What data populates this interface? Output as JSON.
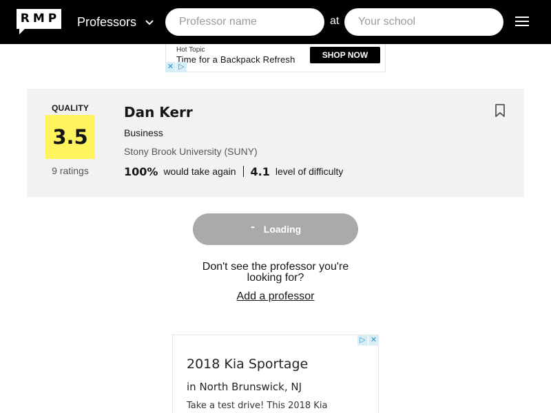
{
  "header": {
    "logo_text": "RMP",
    "search_type": "Professors",
    "professor_placeholder": "Professor name",
    "at_label": "at",
    "school_placeholder": "Your school"
  },
  "top_ad": {
    "brand": "Hot Topic",
    "headline": "Time for a Backpack Refresh",
    "cta": "SHOP NOW"
  },
  "professor": {
    "quality_label": "QUALITY",
    "quality_score": "3.5",
    "ratings_count": "9 ratings",
    "name": "Dan Kerr",
    "department": "Business",
    "school": "Stony Brook University (SUNY)",
    "would_take_again_value": "100%",
    "would_take_again_label": "would take again",
    "difficulty_value": "4.1",
    "difficulty_label": "level of difficulty"
  },
  "loading_label": "Loading",
  "not_found_text": "Don't see the professor you're looking for?",
  "add_professor_label": "Add a professor",
  "bottom_ad": {
    "title": "2018 Kia Sportage",
    "subtitle": "in North Brunswick, NJ",
    "body": "Take a test drive! This 2018 Kia"
  },
  "colors": {
    "header_bg": "#000000",
    "quality_bg": "#fff45d",
    "card_bg": "#f2f2f2",
    "loading_bg": "#aaaaaa"
  },
  "icons": [
    "chevron-down-icon",
    "menu-icon",
    "bookmark-icon",
    "ad-close-icon",
    "adchoices-icon",
    "spinner-icon"
  ]
}
